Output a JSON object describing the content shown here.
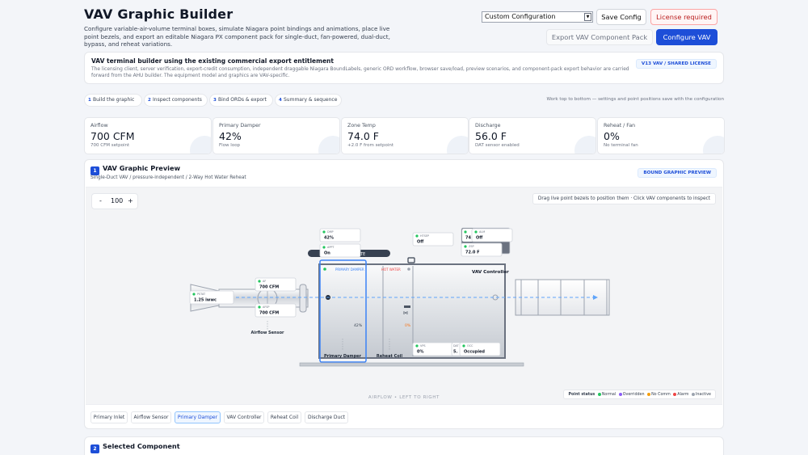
{
  "header": {
    "title": "VAV Graphic Builder",
    "description": "Configure variable-air-volume terminal boxes, simulate Niagara point bindings and animations, place live point bezels, and export an editable Niagara PX component pack for single-duct, fan-powered, dual-duct, bypass, and reheat variations.",
    "config_select": "Custom Configuration",
    "save_label": "Save Config",
    "license_label": "License required",
    "export_label": "Export VAV Component Pack",
    "configure_label": "Configure VAV"
  },
  "notice": {
    "title": "VAV terminal builder using the existing commercial export entitlement",
    "body": "The licensing client, server verification, export-credit consumption, independent draggable Niagara BoundLabels, generic ORD workflow, browser save/load, preview scenarios, and component-pack export behavior are carried forward from the AHU builder. The equipment model and graphics are VAV-specific.",
    "badge": "V13 VAV / SHARED LICENSE"
  },
  "steps": {
    "items": [
      {
        "num": "1",
        "label": "Build the graphic"
      },
      {
        "num": "2",
        "label": "Inspect components"
      },
      {
        "num": "3",
        "label": "Bind ORDs & export"
      },
      {
        "num": "4",
        "label": "Summary & sequence"
      }
    ],
    "hint": "Work top to bottom — settings and point positions save with the configuration"
  },
  "metrics": [
    {
      "label": "Airflow",
      "value": "700 CFM",
      "sub": "700 CFM setpoint"
    },
    {
      "label": "Primary Damper",
      "value": "42%",
      "sub": "Flow loop"
    },
    {
      "label": "Zone Temp",
      "value": "74.0 F",
      "sub": "+2.0 F from setpoint"
    },
    {
      "label": "Discharge",
      "value": "56.0 F",
      "sub": "DAT sensor enabled"
    },
    {
      "label": "Reheat / Fan",
      "value": "0%",
      "sub": "No terminal fan"
    }
  ],
  "preview": {
    "num": "1",
    "title": "VAV Graphic Preview",
    "subtitle": "Single-Duct VAV / pressure-independent / 2-Way Hot Water Reheat",
    "badge": "BOUND GRAPHIC PREVIEW",
    "zoom_minus": "-",
    "zoom_value": "100",
    "zoom_plus": "+",
    "drag_hint": "Drag live point bezels to position them · Click VAV components to inspect",
    "airflow_label": "AIRFLOW • LEFT TO RIGHT",
    "composite_label": "COMPOSITE",
    "damper_section": "PRIMARY DAMPER",
    "hw_section": "HOT WATER",
    "controller_label": "VAV Controller",
    "damper_pct": "42%",
    "reheat_pct": "0%",
    "airflow_sensor_label": "Airflow Sensor",
    "primary_damper_label": "Primary Damper",
    "reheat_coil_label": "Reheat Coil",
    "points": [
      {
        "tag": "DMP",
        "value": "42%",
        "status": "#22c55e"
      },
      {
        "tag": "APPT",
        "value": "On",
        "status": "#22c55e"
      },
      {
        "tag": "HTSEP",
        "value": "Off",
        "status": "#22c55e"
      },
      {
        "tag": "ZT",
        "value": "74",
        "status": "#22c55e"
      },
      {
        "tag": "ALM",
        "value": "Off",
        "status": "#22c55e"
      },
      {
        "tag": "ZSP",
        "value": "72.0 F",
        "status": "#22c55e"
      },
      {
        "tag": "AF",
        "value": "700 CFM",
        "status": "#22c55e"
      },
      {
        "tag": "PSTAT",
        "value": "1.25 iwwc",
        "status": "#22c55e"
      },
      {
        "tag": "AFSP",
        "value": "700 CFM",
        "status": "#22c55e"
      },
      {
        "tag": "VPS",
        "value": "0%",
        "status": "#22c55e"
      },
      {
        "tag": "DAT",
        "value": "5.",
        "status": "#22c55e"
      },
      {
        "tag": "OCC",
        "value": "Occupied",
        "status": "#22c55e"
      }
    ],
    "legend": {
      "title": "Point status",
      "items": [
        {
          "label": "Normal",
          "color": "#22c55e"
        },
        {
          "label": "Overridden",
          "color": "#8b5cf6"
        },
        {
          "label": "No Comm",
          "color": "#f59e0b"
        },
        {
          "label": "Alarm",
          "color": "#ef4444"
        },
        {
          "label": "Inactive",
          "color": "#9ca3af"
        }
      ]
    },
    "component_tabs": [
      {
        "label": "Primary Inlet",
        "active": false
      },
      {
        "label": "Airflow Sensor",
        "active": false
      },
      {
        "label": "Primary Damper",
        "active": true
      },
      {
        "label": "VAV Controller",
        "active": false
      },
      {
        "label": "Reheat Coil",
        "active": false
      },
      {
        "label": "Discharge Duct",
        "active": false
      }
    ]
  },
  "selected": {
    "num": "2",
    "title": "Selected Component"
  }
}
